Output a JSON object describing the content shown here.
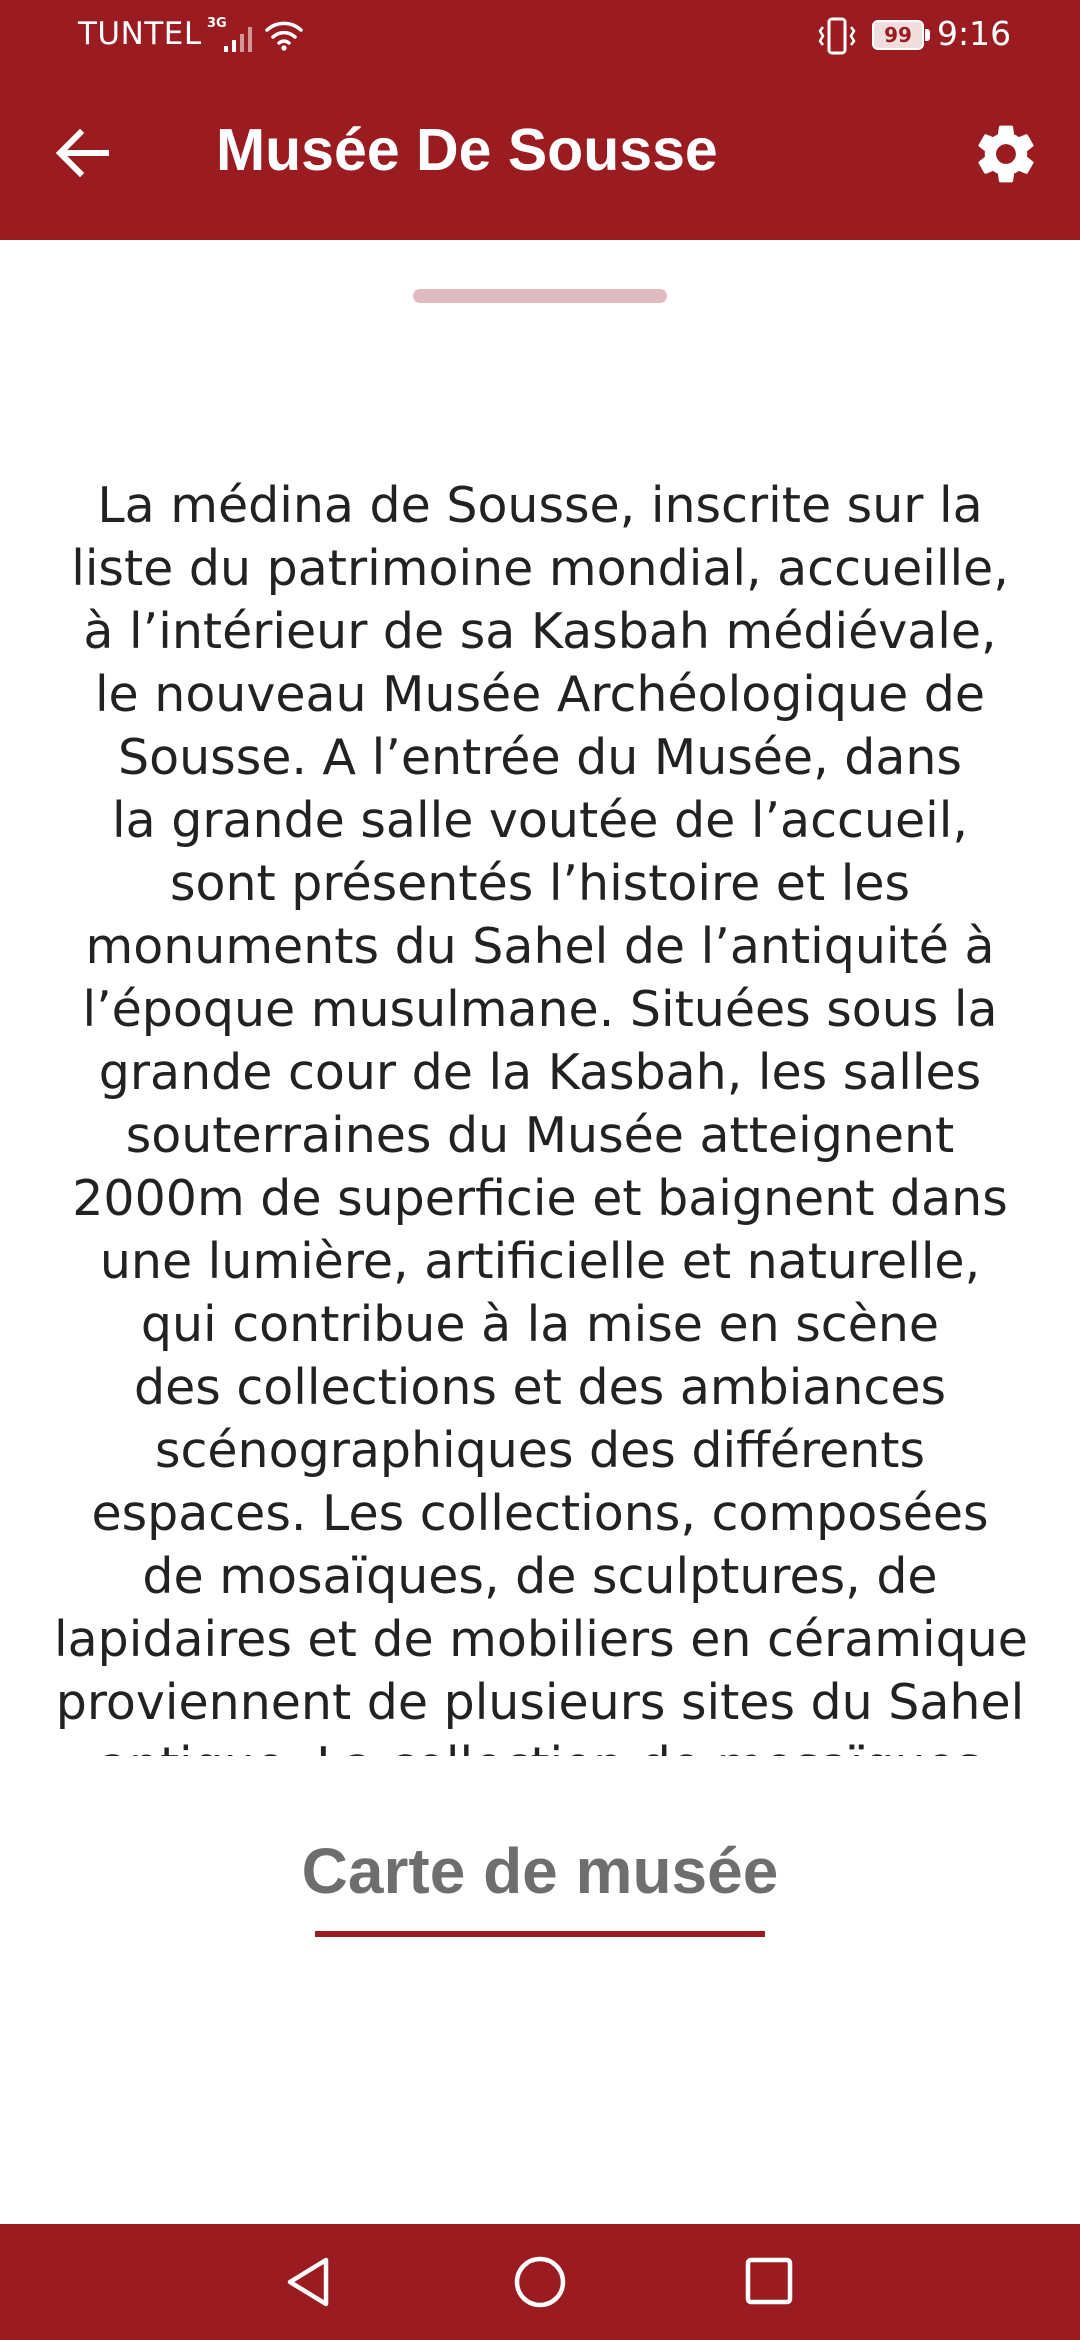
{
  "status_bar": {
    "carrier": "TUNTEL",
    "network_type": "3G",
    "battery_level": "99",
    "time": "9:16"
  },
  "header": {
    "title": "Musée De Sousse",
    "back_icon": "arrow-left-icon",
    "settings_icon": "gear-icon"
  },
  "content": {
    "description_lines": [
      "La médina de Sousse, inscrite sur la",
      "liste du patrimoine mondial, accueille,",
      "à l’intérieur de sa Kasbah médiévale,",
      "le nouveau Musée Archéologique de",
      "Sousse. A l’entrée du Musée, dans",
      "la grande salle voutée de l’accueil,",
      "sont présentés l’histoire et les",
      "monuments du Sahel de l’antiquité à",
      "l’époque musulmane. Situées sous la",
      "grande cour de la Kasbah, les salles",
      "souterraines du Musée atteignent",
      "2000m de superficie et baignent dans",
      "une lumière, artificielle et naturelle,",
      "qui contribue à la mise en scène",
      "des collections et des ambiances",
      "scénographiques des différents",
      "espaces. Les collections, composées",
      "de mosaïques, de sculptures, de",
      "lapidaires et de mobiliers en céramique",
      "proviennent de plusieurs sites du Sahel",
      "antique. La collection de mosaïques"
    ],
    "map_link_label": "Carte de musée"
  },
  "nav_bar": {
    "back_icon": "triangle-back-icon",
    "home_icon": "circle-home-icon",
    "recents_icon": "square-recents-icon"
  },
  "colors": {
    "primary": "#9a1c20",
    "drag_handle": "#dfbbbf",
    "body_text": "#222222",
    "link_text": "#6e6e6e",
    "background": "#ffffff"
  }
}
